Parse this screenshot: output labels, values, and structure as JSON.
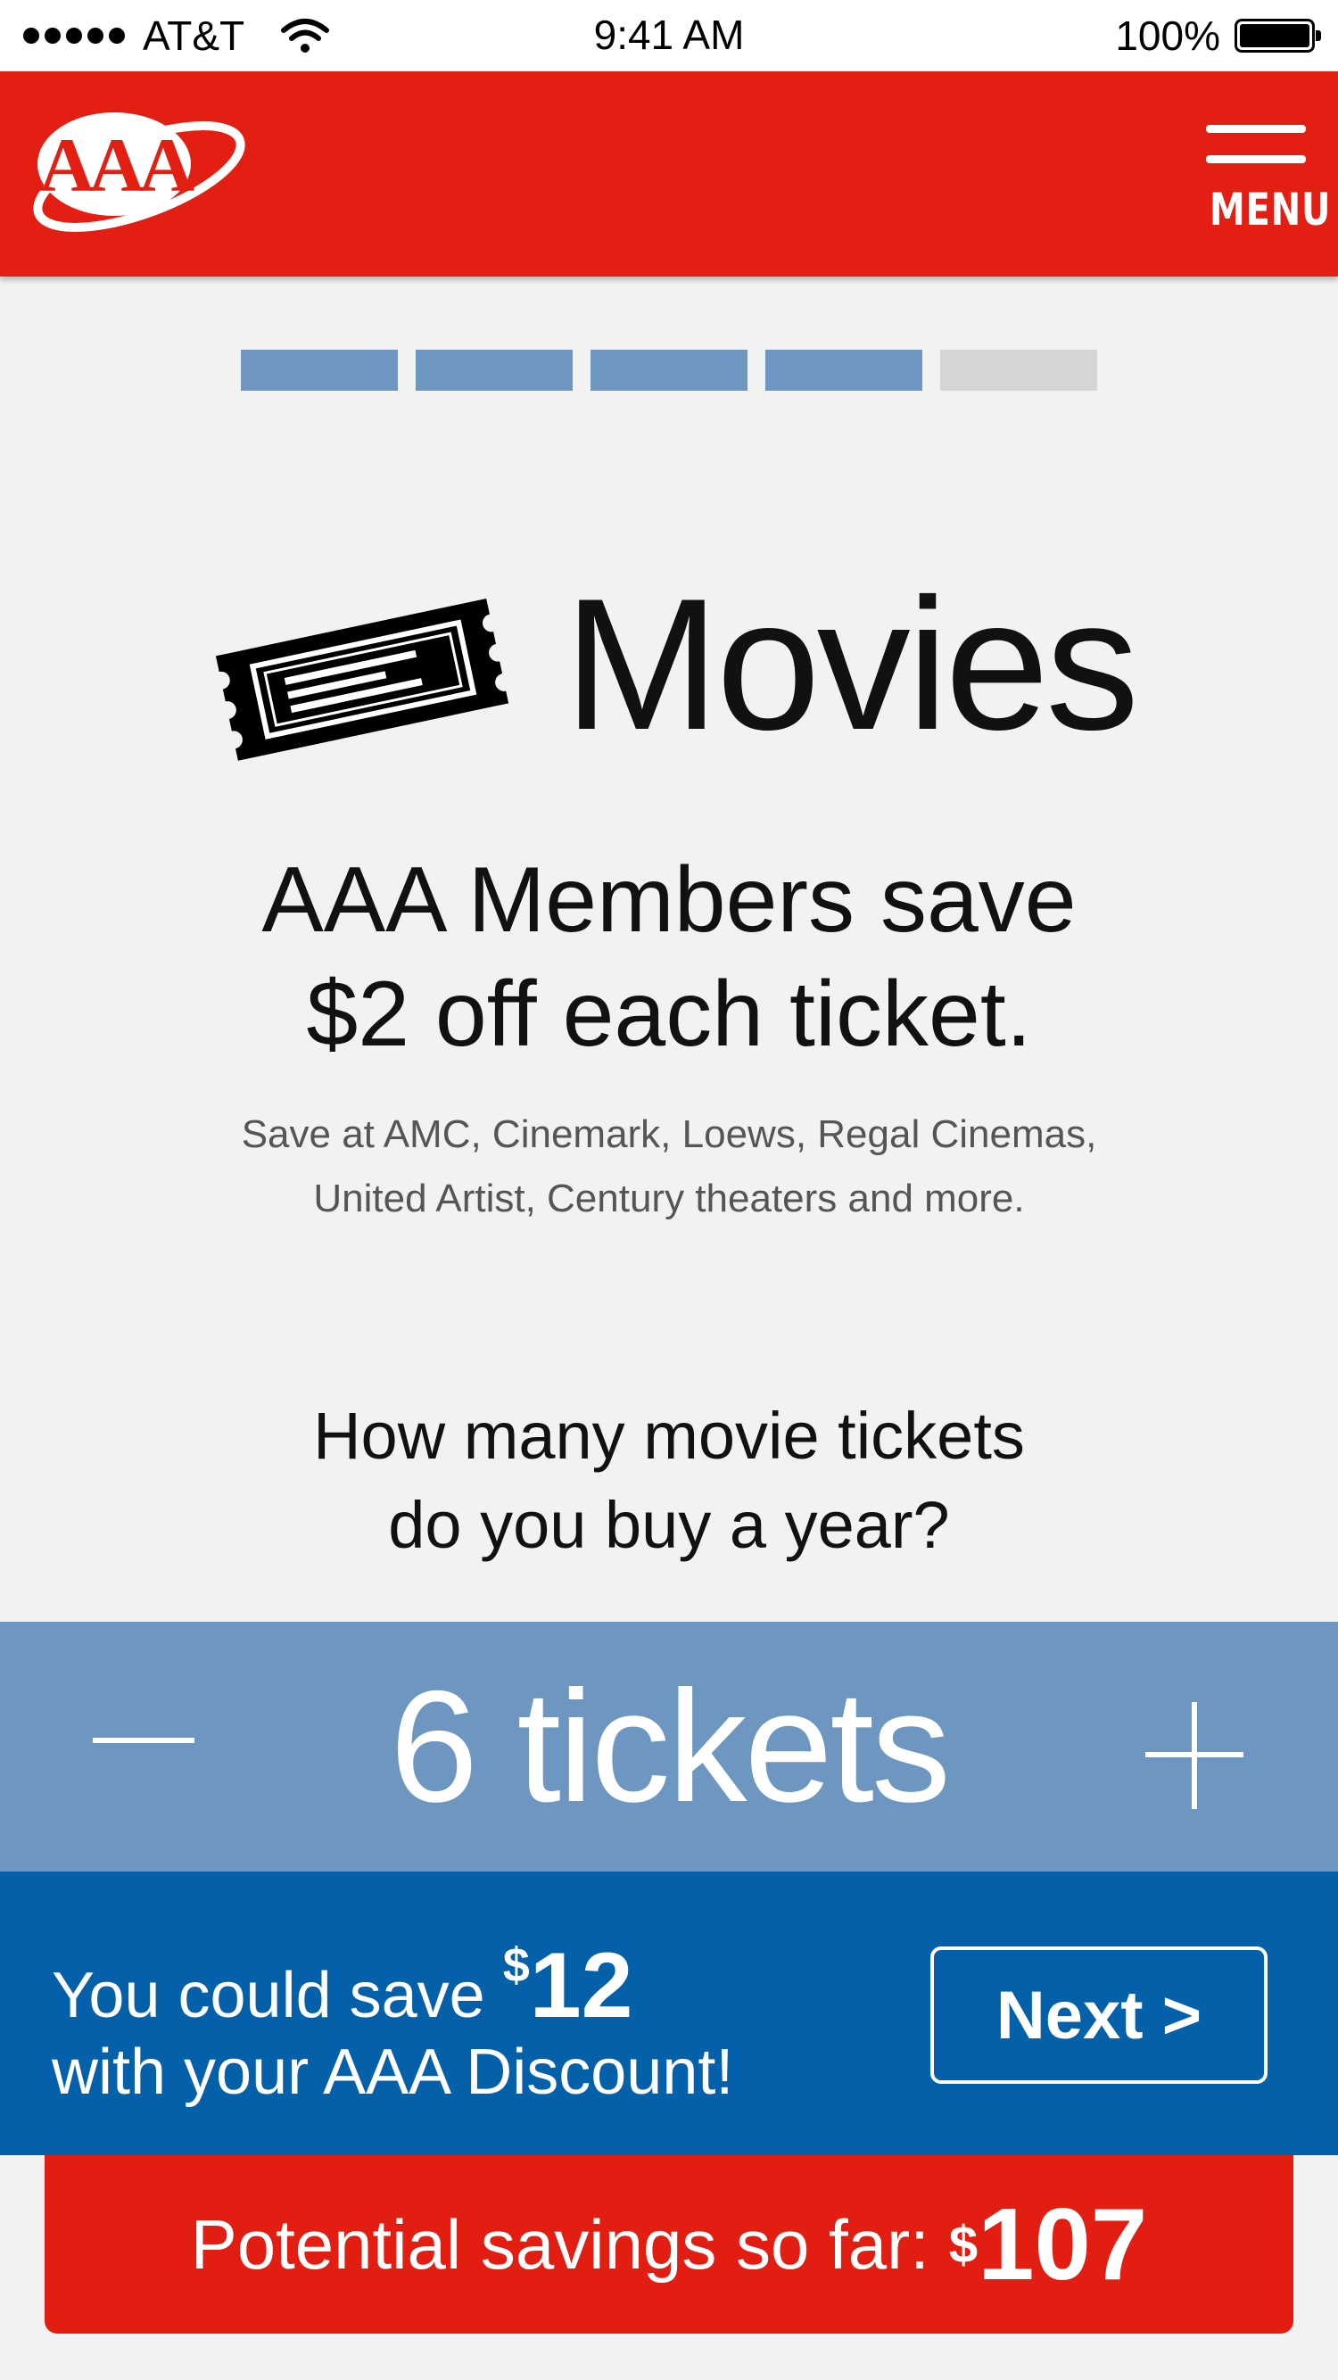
{
  "status_bar": {
    "carrier": "AT&T",
    "time": "9:41 AM",
    "battery": "100%"
  },
  "header": {
    "logo_text": "AAA",
    "menu_label": "MENU"
  },
  "progress": {
    "steps_total": 5,
    "steps_completed": 4
  },
  "category": {
    "icon": "ticket-icon",
    "title": "Movies"
  },
  "offer": {
    "headline_line1": "AAA Members save",
    "headline_line2": "$2 off each ticket.",
    "subtext_line1": "Save at AMC, Cinemark, Loews, Regal Cinemas,",
    "subtext_line2": "United Artist, Century theaters and more."
  },
  "question": {
    "line1": "How many movie tickets",
    "line2": "do you buy a year?"
  },
  "stepper": {
    "value": "6 tickets"
  },
  "savings": {
    "line1_prefix": "You could save ",
    "currency": "$",
    "amount": "12",
    "line2": "with your AAA Discount!",
    "next_label": "Next >"
  },
  "potential": {
    "label": "Potential savings so far:",
    "currency": "$",
    "amount": "107"
  },
  "colors": {
    "brand_red": "#e31e12",
    "stepper_blue": "#6d97c0",
    "band_blue": "#0560aa",
    "background": "#f2f2f2"
  }
}
